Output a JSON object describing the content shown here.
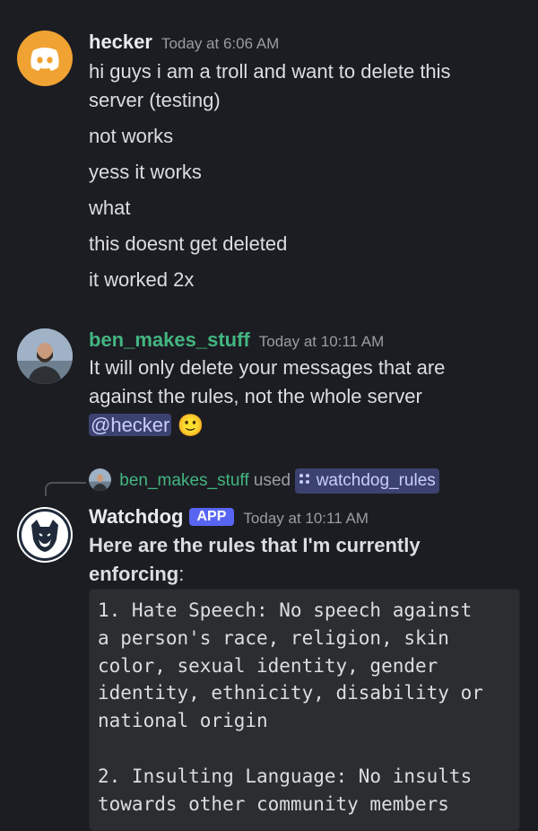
{
  "colors": {
    "background": "#1c1d22",
    "hecker_avatar_bg": "#f0a232",
    "ben_name": "#43b581",
    "mention_bg": "#3c4270",
    "app_badge": "#5865f2"
  },
  "messages": [
    {
      "username": "hecker",
      "timestamp": "Today at 6:06 AM",
      "avatar_icon": "discord-logo-icon",
      "lines": [
        "hi guys i am a troll and want to delete this",
        "server (testing)",
        "not works",
        "yess it works",
        "what",
        "this doesnt get deleted",
        "it worked 2x"
      ]
    },
    {
      "username": "ben_makes_stuff",
      "timestamp": "Today at 10:11 AM",
      "avatar_icon": "user-photo",
      "lines": [
        "It will only delete your messages that are",
        "against the rules, not the whole server"
      ],
      "mention": "@hecker",
      "emoji": "🙂"
    }
  ],
  "command_reply": {
    "username": "ben_makes_stuff",
    "used_text": "used",
    "command": "watchdog_rules"
  },
  "bot_message": {
    "username": "Watchdog",
    "badge": "APP",
    "timestamp": "Today at 10:11 AM",
    "avatar_icon": "watchdog-dog-icon",
    "intro_bold_line1": "Here are the rules that I'm currently",
    "intro_bold_line2": "enforcing",
    "intro_suffix": ":",
    "code_lines": [
      "1. Hate Speech: No speech against",
      "a person's race, religion, skin",
      "color, sexual identity, gender",
      "identity, ethnicity, disability or",
      "national origin",
      "",
      "2. Insulting Language: No insults",
      "towards other community members"
    ]
  }
}
